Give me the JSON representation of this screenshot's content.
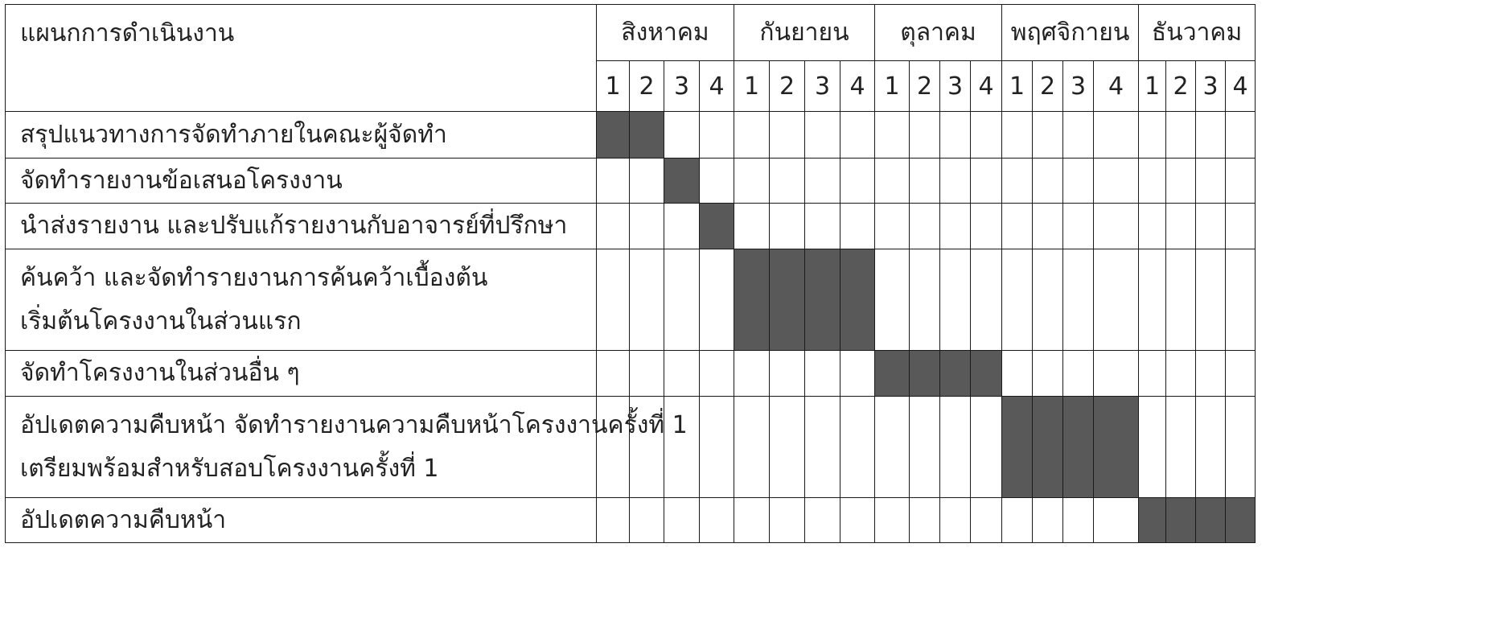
{
  "header": {
    "task_column": "แผนกการดำเนินงาน"
  },
  "months": [
    {
      "name": "สิงหาคม",
      "weeks": [
        "1",
        "2",
        "3",
        "4"
      ]
    },
    {
      "name": "กันยายน",
      "weeks": [
        "1",
        "2",
        "3",
        "4"
      ]
    },
    {
      "name": "ตุลาคม",
      "weeks": [
        "1",
        "2",
        "3",
        "4"
      ]
    },
    {
      "name": "พฤศจิกายน",
      "weeks": [
        "1",
        "2",
        "3",
        "4"
      ]
    },
    {
      "name": "ธันวาคม",
      "weeks": [
        "1",
        "2",
        "3",
        "4"
      ]
    }
  ],
  "tasks": [
    {
      "lines": [
        "สรุปแนวทางการจัดทำภายในคณะผู้จัดทำ"
      ],
      "active_weeks": [
        0,
        1
      ]
    },
    {
      "lines": [
        "จัดทำรายงานข้อเสนอโครงงาน"
      ],
      "active_weeks": [
        2
      ]
    },
    {
      "lines": [
        "นำส่งรายงาน และปรับแก้รายงานกับอาจารย์ที่ปรึกษา"
      ],
      "active_weeks": [
        3
      ]
    },
    {
      "lines": [
        "ค้นคว้า และจัดทำรายงานการค้นคว้าเบื้องต้น",
        "เริ่มต้นโครงงานในส่วนแรก"
      ],
      "active_weeks": [
        4,
        5,
        6,
        7
      ]
    },
    {
      "lines": [
        "จัดทำโครงงานในส่วนอื่น ๆ"
      ],
      "active_weeks": [
        8,
        9,
        10,
        11
      ]
    },
    {
      "lines": [
        "อัปเดตความคืบหน้า จัดทำรายงานความคืบหน้าโครงงานครั้งที่ 1",
        "เตรียมพร้อมสำหรับสอบโครงงานครั้งที่ 1"
      ],
      "active_weeks": [
        12,
        13,
        14,
        15
      ]
    },
    {
      "lines": [
        "อัปเดตความคืบหน้า"
      ],
      "active_weeks": [
        16,
        17,
        18,
        19
      ]
    }
  ],
  "colors": {
    "filled_cell": "#595959",
    "grid_line": "#1a1a1a"
  }
}
